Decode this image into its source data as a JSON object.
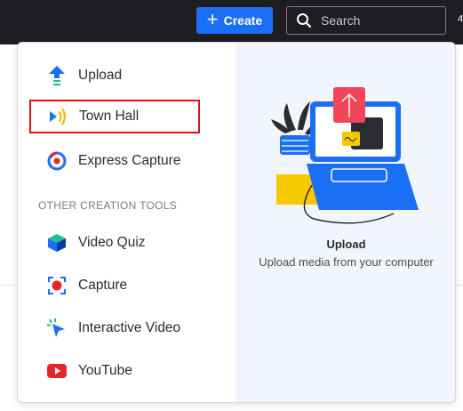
{
  "topbar": {
    "create_label": "Create",
    "search_placeholder": "Search"
  },
  "menu": {
    "items": [
      {
        "label": "Upload",
        "icon": "upload-arrow-icon"
      },
      {
        "label": "Town Hall",
        "icon": "town-hall-broadcast-icon",
        "selected": true
      },
      {
        "label": "Express Capture",
        "icon": "express-capture-icon"
      }
    ],
    "section_label": "OTHER CREATION TOOLS",
    "other_items": [
      {
        "label": "Video Quiz",
        "icon": "cube-icon"
      },
      {
        "label": "Capture",
        "icon": "record-capture-icon"
      },
      {
        "label": "Interactive Video",
        "icon": "cursor-click-icon"
      },
      {
        "label": "YouTube",
        "icon": "youtube-icon"
      }
    ]
  },
  "preview": {
    "title": "Upload",
    "description": "Upload media from your computer"
  },
  "colors": {
    "accent": "#1b6ff4",
    "topbar": "#1d1d22",
    "selected_border": "#e0101a",
    "preview_bg": "#f2f5fc"
  }
}
